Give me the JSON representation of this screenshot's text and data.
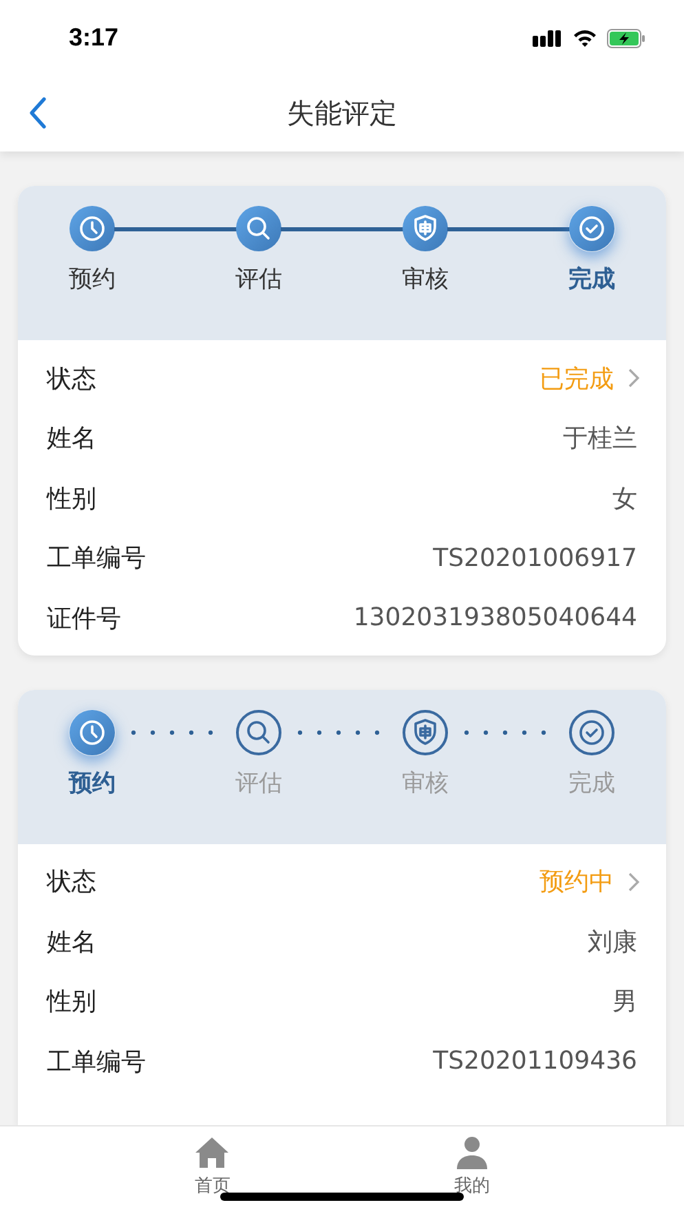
{
  "status_bar": {
    "time": "3:17"
  },
  "nav": {
    "title": "失能评定"
  },
  "cards": [
    {
      "steps": [
        {
          "label": "预约",
          "done": true,
          "selected": false
        },
        {
          "label": "评估",
          "done": true,
          "selected": false
        },
        {
          "label": "审核",
          "done": true,
          "selected": false
        },
        {
          "label": "完成",
          "done": true,
          "selected": true
        }
      ],
      "rows": [
        {
          "kind": "status",
          "label": "状态",
          "value": "已完成"
        },
        {
          "kind": "plain",
          "label": "姓名",
          "value": "于桂兰"
        },
        {
          "kind": "plain",
          "label": "性别",
          "value": "女"
        },
        {
          "kind": "plain",
          "label": "工单编号",
          "value": "TS20201006917"
        },
        {
          "kind": "plain",
          "label": "证件号",
          "value": "130203193805040644"
        }
      ]
    },
    {
      "steps": [
        {
          "label": "预约",
          "done": true,
          "selected": true
        },
        {
          "label": "评估",
          "done": false,
          "selected": false
        },
        {
          "label": "审核",
          "done": false,
          "selected": false
        },
        {
          "label": "完成",
          "done": false,
          "selected": false
        }
      ],
      "rows": [
        {
          "kind": "status",
          "label": "状态",
          "value": "预约中"
        },
        {
          "kind": "plain",
          "label": "姓名",
          "value": "刘康"
        },
        {
          "kind": "plain",
          "label": "性别",
          "value": "男"
        },
        {
          "kind": "plain",
          "label": "工单编号",
          "value": "TS20201109436"
        }
      ]
    }
  ],
  "tab_bar": [
    {
      "label": "首页",
      "selected": false
    },
    {
      "label": "我的",
      "selected": false
    }
  ]
}
